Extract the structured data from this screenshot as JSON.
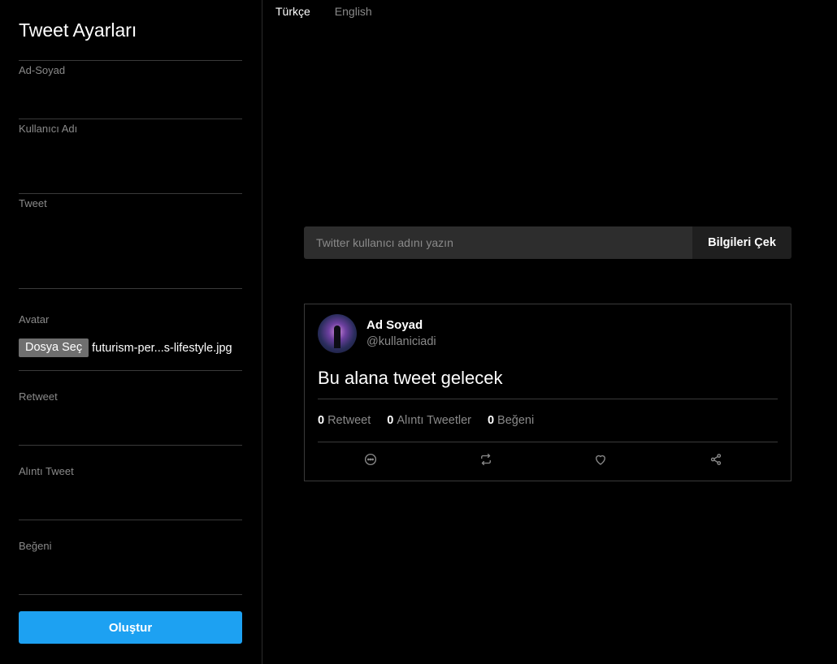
{
  "sidebar": {
    "title": "Tweet Ayarları",
    "fields": {
      "name_label": "Ad-Soyad",
      "username_label": "Kullanıcı Adı",
      "tweet_label": "Tweet",
      "avatar_label": "Avatar",
      "retweet_label": "Retweet",
      "quote_label": "Alıntı Tweet",
      "like_label": "Beğeni"
    },
    "avatar_file": {
      "button_label": "Dosya Seç",
      "file_name": "futurism-per...s-lifestyle.jpg"
    },
    "submit_label": "Oluştur"
  },
  "language": {
    "options": [
      "Türkçe",
      "English"
    ],
    "selected": "Türkçe"
  },
  "search": {
    "placeholder": "Twitter kullanıcı adını yazın",
    "button_label": "Bilgileri Çek"
  },
  "tweet": {
    "name": "Ad Soyad",
    "handle": "@kullaniciadi",
    "text": "Bu alana tweet gelecek",
    "stats": {
      "retweet_count": "0",
      "retweet_label": "Retweet",
      "quote_count": "0",
      "quote_label": "Alıntı Tweetler",
      "like_count": "0",
      "like_label": "Beğeni"
    },
    "actions": [
      "comment-icon",
      "retweet-icon",
      "heart-icon",
      "share-icon"
    ]
  },
  "colors": {
    "background": "#000000",
    "accent": "#1da1f2",
    "muted_text": "#8a8a8a",
    "border": "#3a3a3a"
  }
}
